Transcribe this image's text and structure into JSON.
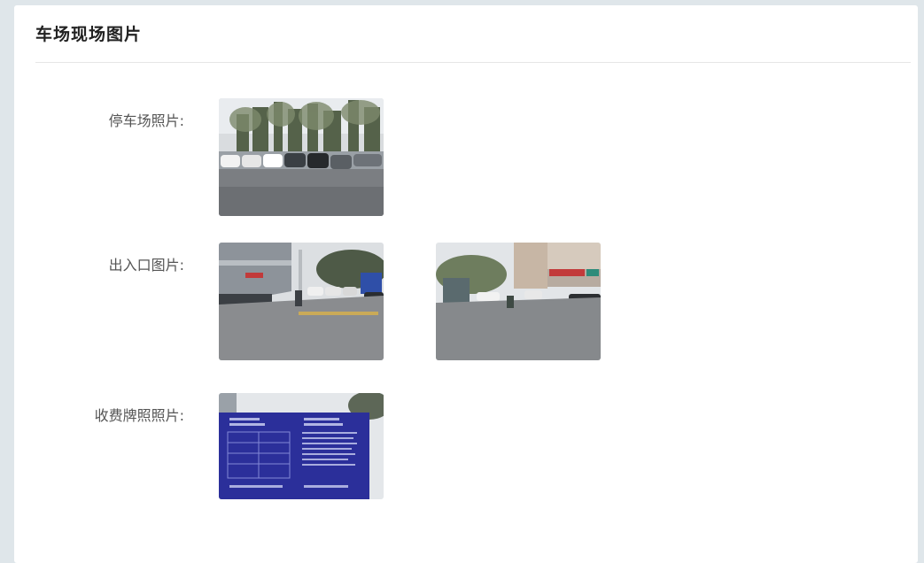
{
  "card": {
    "title": "车场现场图片"
  },
  "rows": [
    {
      "label": "停车场照片:",
      "images": [
        {
          "subject": "parking-lot-photo"
        }
      ]
    },
    {
      "label": "出入口图片:",
      "images": [
        {
          "subject": "entrance-photo-1"
        },
        {
          "subject": "entrance-photo-2"
        }
      ]
    },
    {
      "label": "收费牌照照片:",
      "images": [
        {
          "subject": "fee-sign-photo"
        }
      ]
    }
  ]
}
